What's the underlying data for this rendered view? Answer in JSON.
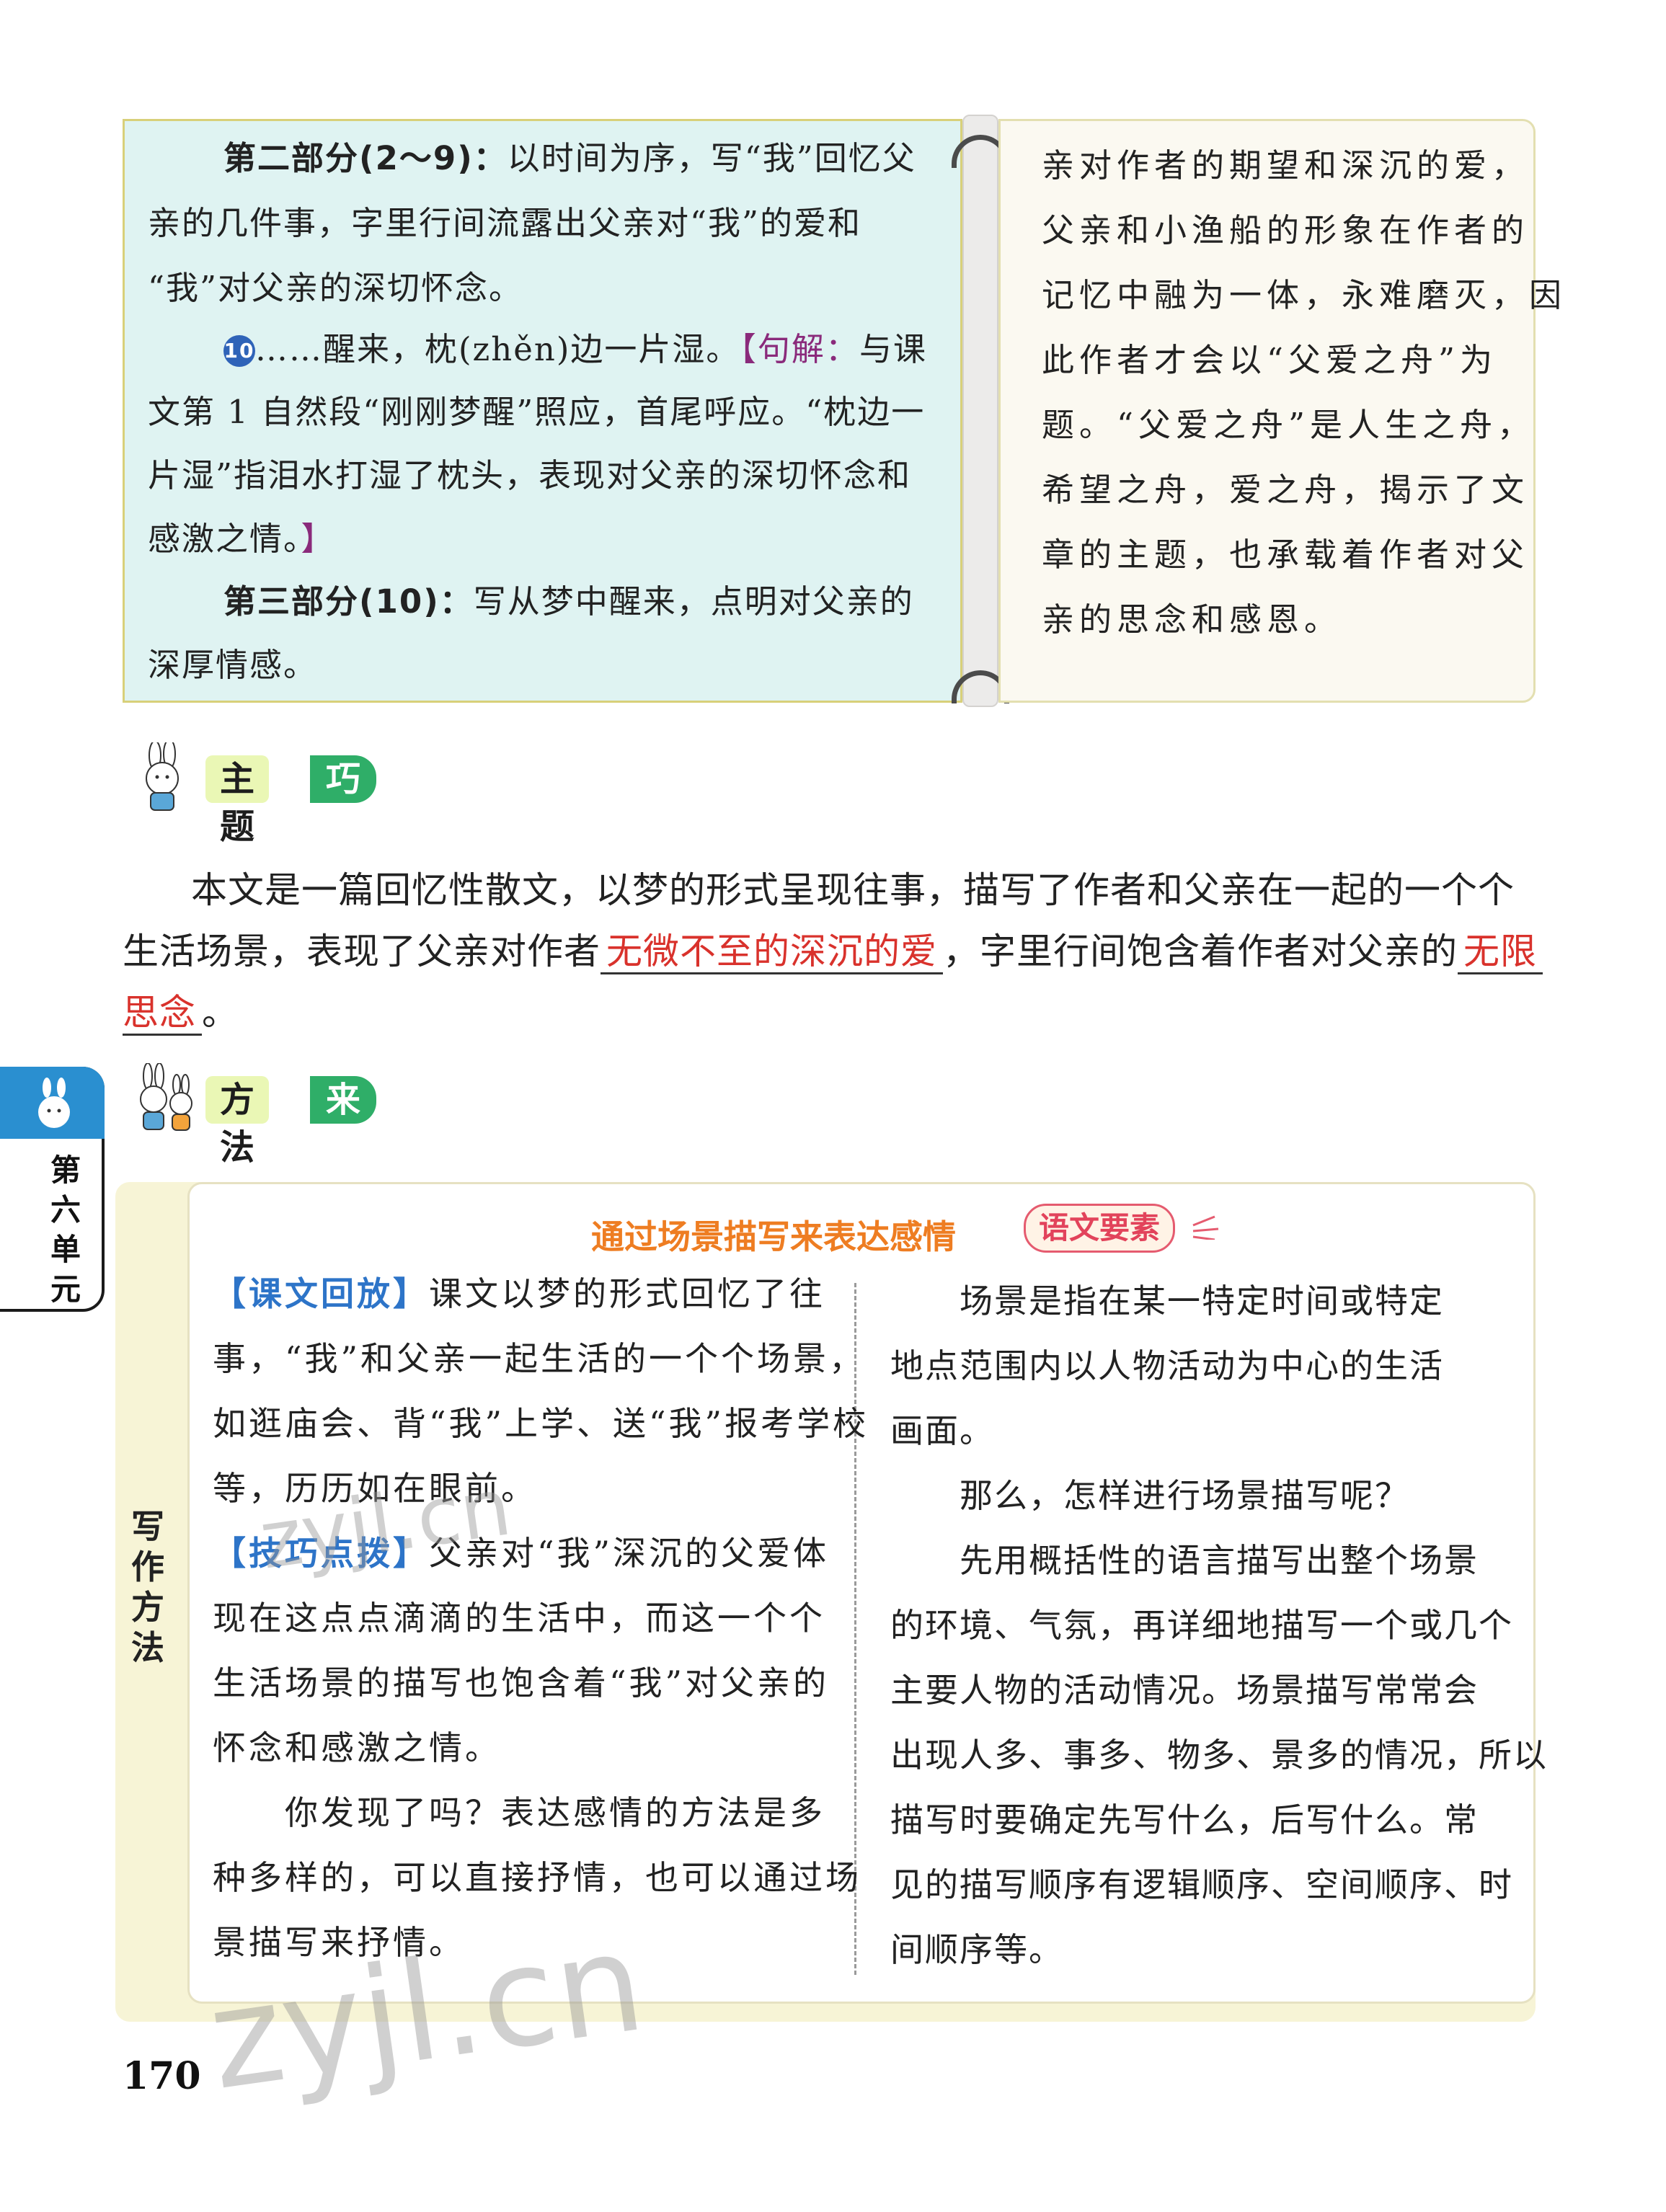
{
  "top_panel": {
    "left_lines": [
      {
        "bold": "第二部分(2～9)：",
        "text": "以时间为序，写“我”回忆父"
      },
      {
        "text": "亲的几件事，字里行间流露出父亲对“我”的爱和"
      },
      {
        "text": "“我”对父亲的深切怀念。"
      },
      {
        "num": "10",
        "text": "……醒来，枕(zhěn)边一片湿。",
        "tag": "【句解：",
        "tag_text": "与课"
      },
      {
        "text": "文第 1 自然段“刚刚梦醒”照应，首尾呼应。“枕边一"
      },
      {
        "text": "片湿”指泪水打湿了枕头，表现对父亲的深切怀念和"
      },
      {
        "text": "感激之情。",
        "tag_end": "】"
      },
      {
        "bold": "第三部分(10)：",
        "text": "写从梦中醒来，点明对父亲的"
      },
      {
        "text": "深厚情感。"
      }
    ],
    "right_lines": [
      "亲对作者的期望和深沉的爱，",
      "父亲和小渔船的形象在作者的",
      "记忆中融为一体，永难磨灭，因",
      "此作者才会以“父爱之舟”为",
      "题。“父爱之舟”是人生之舟，",
      "希望之舟，爱之舟，揭示了文",
      "章的主题，也承载着作者对父",
      "亲的思念和感恩。"
    ]
  },
  "theme_section": {
    "title_main": "主题",
    "title_sub": "巧归纳",
    "line1": "本文是一篇回忆性散文，以梦的形式呈现往事，描写了作者和父亲在一起的一个个",
    "line2_a": "生活场景，表现了父亲对作者",
    "fill1": "无微不至的深沉的爱",
    "line2_b": "，字里行间饱含着作者对父亲的",
    "fill2a": "无限",
    "fill2b": "思念",
    "line3_end": "。"
  },
  "side_tab": {
    "chars": [
      "第",
      "六",
      "单",
      "元"
    ]
  },
  "method_section": {
    "title_main": "方法",
    "title_sub": "来总结",
    "side_label": [
      "写",
      "作",
      "方",
      "法"
    ],
    "box_title": "通过场景描写来表达感情",
    "badge": "语文要素",
    "left_lines": [
      {
        "tag": "【课文回放】",
        "text": "课文以梦的形式回忆了往"
      },
      {
        "text": "事，“我”和父亲一起生活的一个个场景，"
      },
      {
        "text": "如逛庙会、背“我”上学、送“我”报考学校"
      },
      {
        "text": "等，历历如在眼前。"
      },
      {
        "tag": "【技巧点拨】",
        "text": "父亲对“我”深沉的父爱体"
      },
      {
        "text": "现在这点点滴滴的生活中，而这一个个"
      },
      {
        "text": "生活场景的描写也饱含着“我”对父亲的"
      },
      {
        "text": "怀念和感激之情。"
      },
      {
        "text": "　　你发现了吗？表达感情的方法是多"
      },
      {
        "text": "种多样的，可以直接抒情，也可以通过场"
      },
      {
        "text": "景描写来抒情。"
      }
    ],
    "right_lines": [
      "　　场景是指在某一特定时间或特定",
      "地点范围内以人物活动为中心的生活",
      "画面。",
      "　　那么，怎样进行场景描写呢？",
      "　　先用概括性的语言描写出整个场景",
      "的环境、气氛，再详细地描写一个或几个",
      "主要人物的活动情况。场景描写常常会",
      "出现人多、事多、物多、景多的情况，所以",
      "描写时要确定先写什么，后写什么。常",
      "见的描写顺序有逻辑顺序、空间顺序、时",
      "间顺序等。"
    ]
  },
  "watermarks": [
    "zyjl.cn",
    "zyjl.cn"
  ],
  "page_number": "170"
}
